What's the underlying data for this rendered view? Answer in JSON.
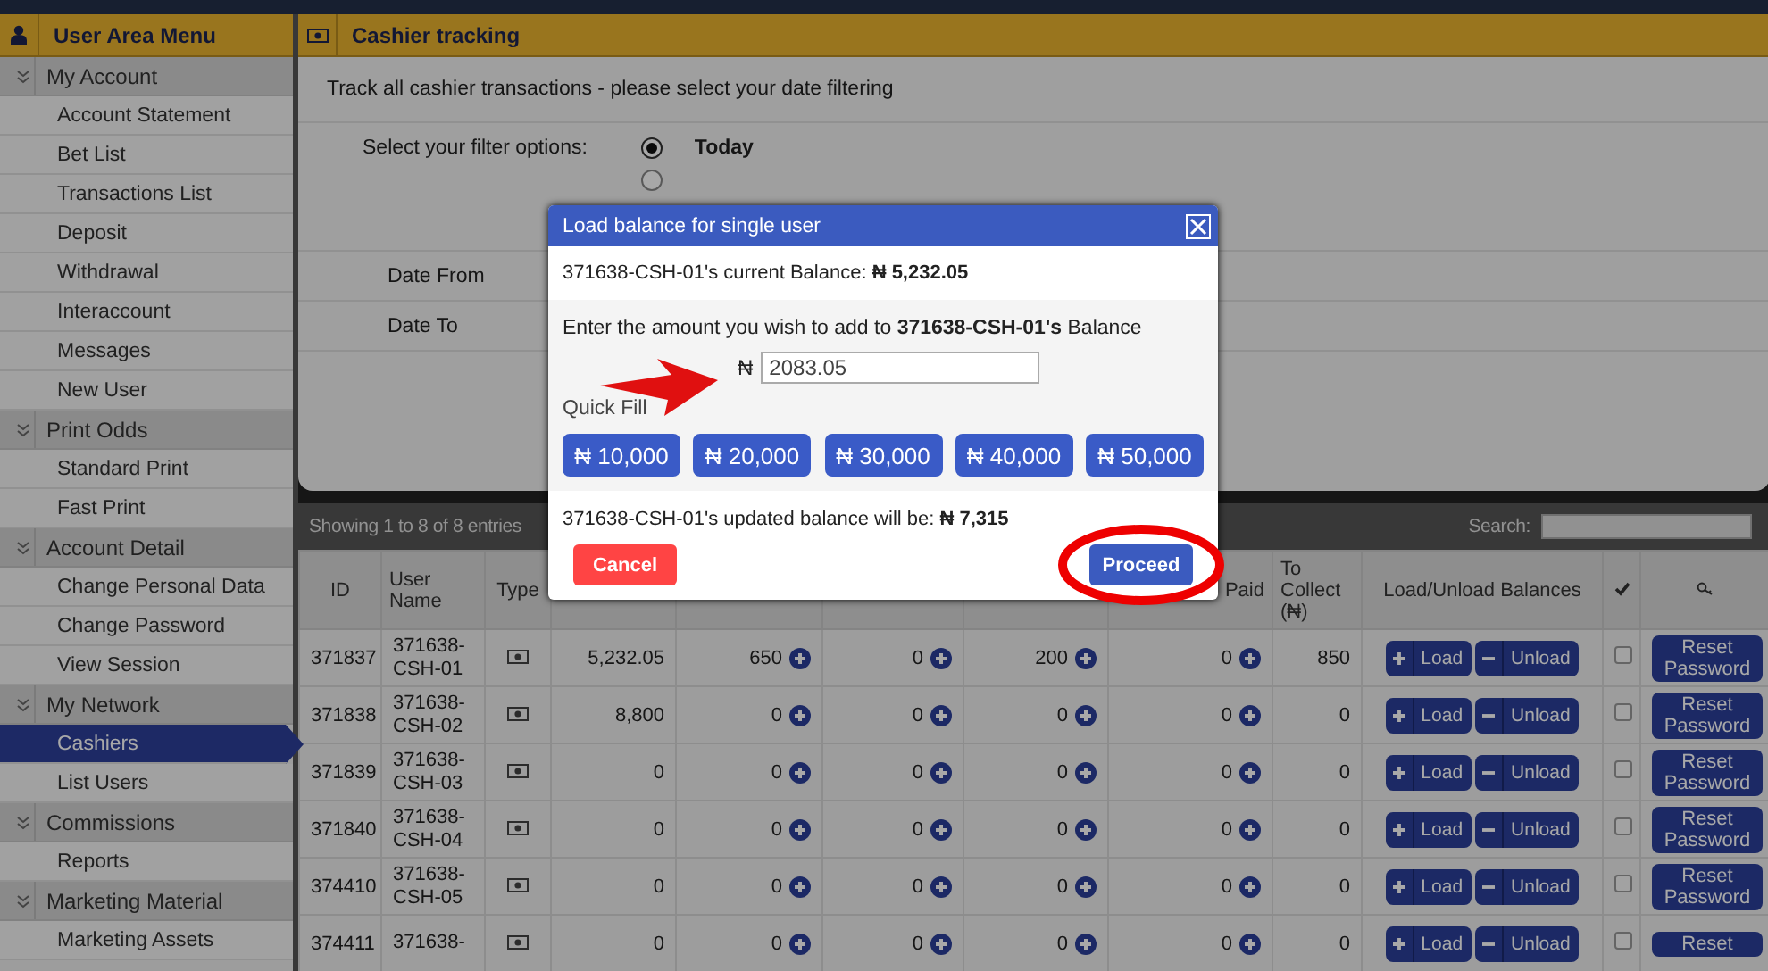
{
  "sidebar": {
    "title": "User Area Menu",
    "sections": [
      {
        "label": "My Account",
        "expanded": true,
        "items": [
          {
            "label": "Account Statement",
            "selected": false
          },
          {
            "label": "Bet List",
            "selected": false
          },
          {
            "label": "Transactions List",
            "selected": false
          },
          {
            "label": "Deposit",
            "selected": false
          },
          {
            "label": "Withdrawal",
            "selected": false
          },
          {
            "label": "Interaccount",
            "selected": false
          },
          {
            "label": "Messages",
            "selected": false
          },
          {
            "label": "New User",
            "selected": false
          }
        ]
      },
      {
        "label": "Print Odds",
        "expanded": true,
        "items": [
          {
            "label": "Standard Print",
            "selected": false
          },
          {
            "label": "Fast Print",
            "selected": false
          }
        ]
      },
      {
        "label": "Account Detail",
        "expanded": true,
        "items": [
          {
            "label": "Change Personal Data",
            "selected": false
          },
          {
            "label": "Change Password",
            "selected": false
          },
          {
            "label": "View Session",
            "selected": false
          }
        ]
      },
      {
        "label": "My Network",
        "expanded": true,
        "items": [
          {
            "label": "Cashiers",
            "selected": true
          },
          {
            "label": "List Users",
            "selected": false
          }
        ]
      },
      {
        "label": "Commissions",
        "expanded": true,
        "items": [
          {
            "label": "Reports",
            "selected": false
          }
        ]
      },
      {
        "label": "Marketing Material",
        "expanded": true,
        "items": [
          {
            "label": "Marketing Assets",
            "selected": false
          }
        ]
      }
    ]
  },
  "main": {
    "title": "Cashier tracking",
    "intro": "Track all cashier transactions - please select your date filtering",
    "filter_label": "Select your filter options:",
    "filter_options": [
      {
        "label": "Today",
        "selected": true
      },
      {
        "selected": false
      }
    ],
    "date_from_label": "Date From",
    "date_to_label": "Date To"
  },
  "table": {
    "summary": "Showing 1 to 8 of 8 entries",
    "search_label": "Search:",
    "columns": [
      {
        "label": "ID"
      },
      {
        "label": "User Name"
      },
      {
        "label": "Type"
      },
      {},
      {},
      {},
      {},
      {
        "label": "Paid"
      },
      {
        "label": "To Collect (₦)"
      },
      {
        "label": "Load/Unload Balances"
      },
      {
        "kind": "check"
      },
      {
        "kind": "key"
      }
    ],
    "rows": [
      {
        "id": "371837",
        "user": "371638-CSH-01",
        "balance": "5,232.05",
        "col5": "650",
        "col6": "0",
        "col7": "200",
        "paid": "0",
        "to_collect": "850",
        "checked": false,
        "load": "Load",
        "unload": "Unload",
        "reset": "Reset Password"
      },
      {
        "id": "371838",
        "user": "371638-CSH-02",
        "balance": "8,800",
        "col5": "0",
        "col6": "0",
        "col7": "0",
        "paid": "0",
        "to_collect": "0",
        "checked": false,
        "load": "Load",
        "unload": "Unload",
        "reset": "Reset Password"
      },
      {
        "id": "371839",
        "user": "371638-CSH-03",
        "balance": "0",
        "col5": "0",
        "col6": "0",
        "col7": "0",
        "paid": "0",
        "to_collect": "0",
        "checked": false,
        "load": "Load",
        "unload": "Unload",
        "reset": "Reset Password"
      },
      {
        "id": "371840",
        "user": "371638-CSH-04",
        "balance": "0",
        "col5": "0",
        "col6": "0",
        "col7": "0",
        "paid": "0",
        "to_collect": "0",
        "checked": false,
        "load": "Load",
        "unload": "Unload",
        "reset": "Reset Password"
      },
      {
        "id": "374410",
        "user": "371638-CSH-05",
        "balance": "0",
        "col5": "0",
        "col6": "0",
        "col7": "0",
        "paid": "0",
        "to_collect": "0",
        "checked": false,
        "load": "Load",
        "unload": "Unload",
        "reset": "Reset Password"
      },
      {
        "id": "374411",
        "user": "371638-",
        "balance": "0",
        "col5": "0",
        "col6": "0",
        "col7": "0",
        "paid": "0",
        "to_collect": "0",
        "checked": false,
        "load": "Load",
        "unload": "Unload",
        "reset": "Reset"
      }
    ]
  },
  "dialog": {
    "title": "Load balance for single user",
    "current_balance": "371638-CSH-01's current Balance: **₦ 5,232.05**",
    "prompt": "Enter the amount you wish to add to **371638-CSH-01's** Balance",
    "currency_symbol": "₦",
    "amount": "2083.05",
    "quick_fill_label": "Quick Fill",
    "quick_fill": [
      "₦ 10,000",
      "₦ 20,000",
      "₦ 30,000",
      "₦ 40,000",
      "₦ 50,000"
    ],
    "updated_balance": "371638-CSH-01's updated balance will be: **₦ 7,315**",
    "cancel": "Cancel",
    "proceed": "Proceed"
  }
}
